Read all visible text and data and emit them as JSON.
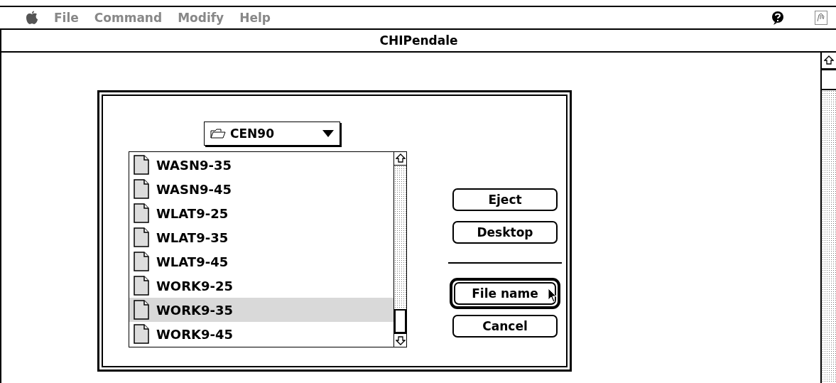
{
  "menu_bar": {
    "items": [
      {
        "label": "File",
        "disabled": true
      },
      {
        "label": "Command",
        "disabled": true
      },
      {
        "label": "Modify",
        "disabled": true
      },
      {
        "label": "Help",
        "disabled": true
      }
    ]
  },
  "window": {
    "title": "CHIPendale"
  },
  "dialog": {
    "folder_popup": {
      "label": "CEN90"
    },
    "files": [
      {
        "name": "WASN9-35",
        "selected": false
      },
      {
        "name": "WASN9-45",
        "selected": false
      },
      {
        "name": "WLAT9-25",
        "selected": false
      },
      {
        "name": "WLAT9-35",
        "selected": false
      },
      {
        "name": "WLAT9-45",
        "selected": false
      },
      {
        "name": "WORK9-25",
        "selected": false
      },
      {
        "name": "WORK9-35",
        "selected": true
      },
      {
        "name": "WORK9-45",
        "selected": false
      }
    ],
    "buttons": [
      {
        "label": "Eject",
        "kind": "normal"
      },
      {
        "label": "Desktop",
        "kind": "normal"
      },
      {
        "kind": "divider"
      },
      {
        "label": "File name",
        "kind": "default"
      },
      {
        "label": "Cancel",
        "kind": "normal"
      }
    ]
  }
}
